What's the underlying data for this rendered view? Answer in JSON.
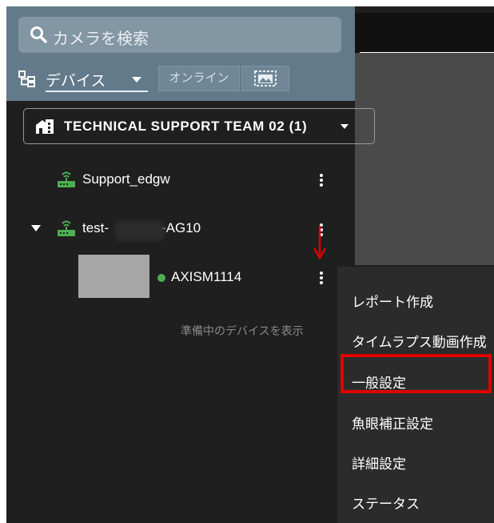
{
  "search": {
    "placeholder": "カメラを検索",
    "icon": "search-icon"
  },
  "device_filter": {
    "view_label": "デバイス",
    "online_label": "オンライン",
    "image_toggle_icon": "image-icon"
  },
  "team": {
    "name": "TECHNICAL SUPPORT TEAM 02 (1)",
    "icon": "building-icon"
  },
  "devices": [
    {
      "name": "Support_edgw",
      "icon": "router-icon"
    },
    {
      "name_prefix": "test-",
      "name_suffix": "-AG10",
      "icon": "router-icon",
      "expanded": true
    }
  ],
  "camera": {
    "name": "AXISM1114",
    "status_color": "#4caf50"
  },
  "show_pending_label": "準備中のデバイスを表示",
  "context_menu": {
    "items": [
      "レポート作成",
      "タイムラプス動画作成",
      "一般設定",
      "魚眼補正設定",
      "詳細設定",
      "ステータス"
    ],
    "highlighted_index": 2
  },
  "colors": {
    "accent_red": "#e00000",
    "online_green": "#4caf50",
    "header_bg": "#627a8a"
  }
}
